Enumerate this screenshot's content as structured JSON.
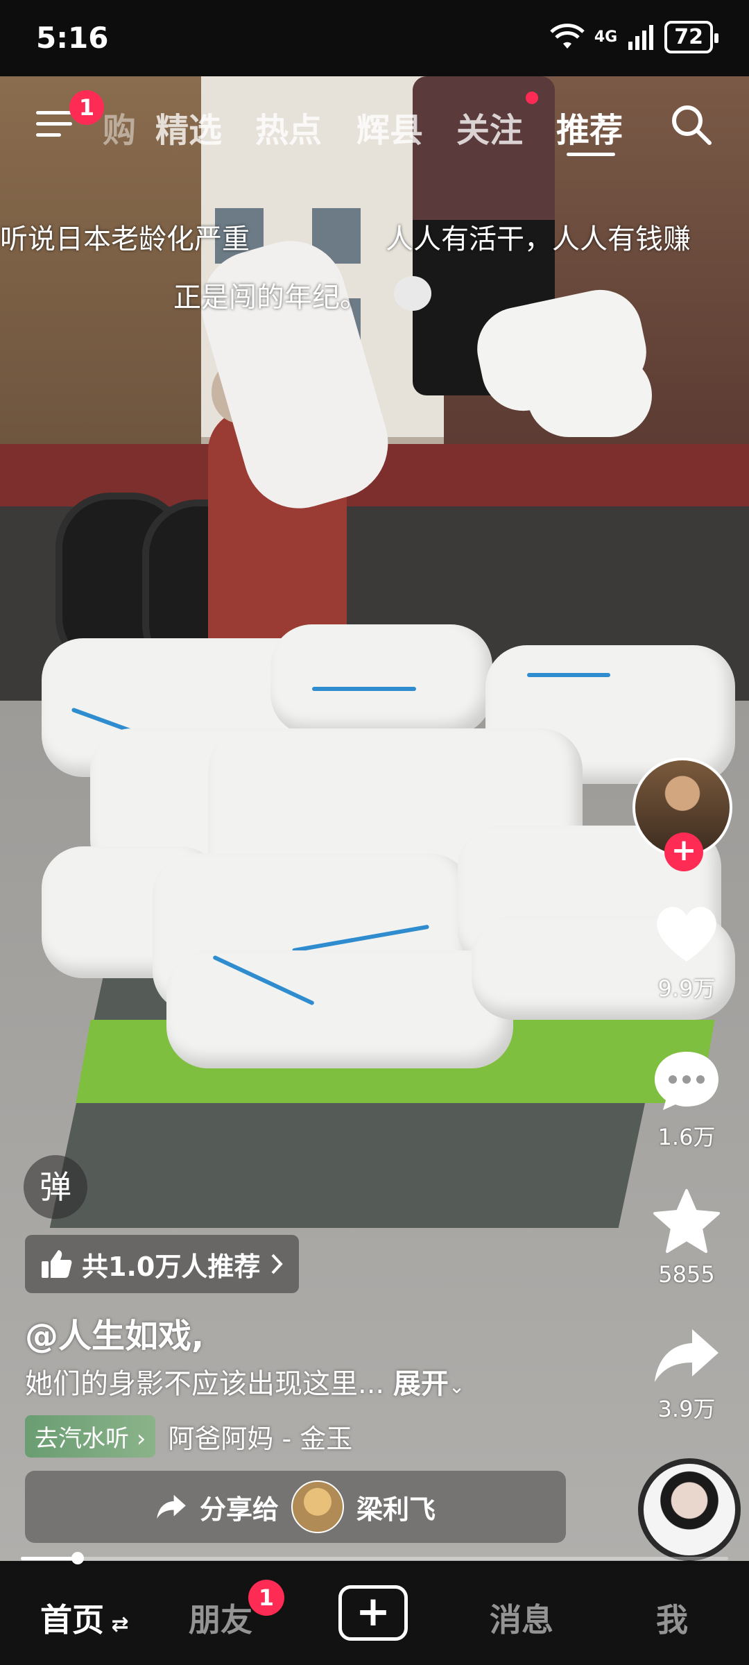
{
  "status_bar": {
    "time": "5:16",
    "network": "4G",
    "battery": "72"
  },
  "top_nav": {
    "menu_badge": "1",
    "tabs": [
      "购",
      "精选",
      "热点",
      "辉县",
      "关注",
      "推荐"
    ],
    "active_tab": "推荐",
    "follow_has_dot": true
  },
  "danmaku": [
    "听说日本老龄化严重",
    "人人有活干，人人有钱赚",
    "正是闯的年纪。"
  ],
  "rail": {
    "likes": "9.9万",
    "comments": "1.6万",
    "favorites": "5855",
    "shares": "3.9万"
  },
  "danmu_toggle": "弹",
  "recommend": {
    "label": "共1.0万人推荐"
  },
  "author": "@人生如戏,",
  "description": {
    "text": "她们的身影不应该出现这里...",
    "expand": "展开"
  },
  "music": {
    "tag": "去汽水听",
    "title": "阿爸阿妈 - 金玉"
  },
  "share": {
    "label": "分享给",
    "friend": "梁利飞"
  },
  "progress": 0.08,
  "bottom_tabs": {
    "home": "首页",
    "friends": "朋友",
    "friends_badge": "1",
    "messages": "消息",
    "me": "我"
  }
}
